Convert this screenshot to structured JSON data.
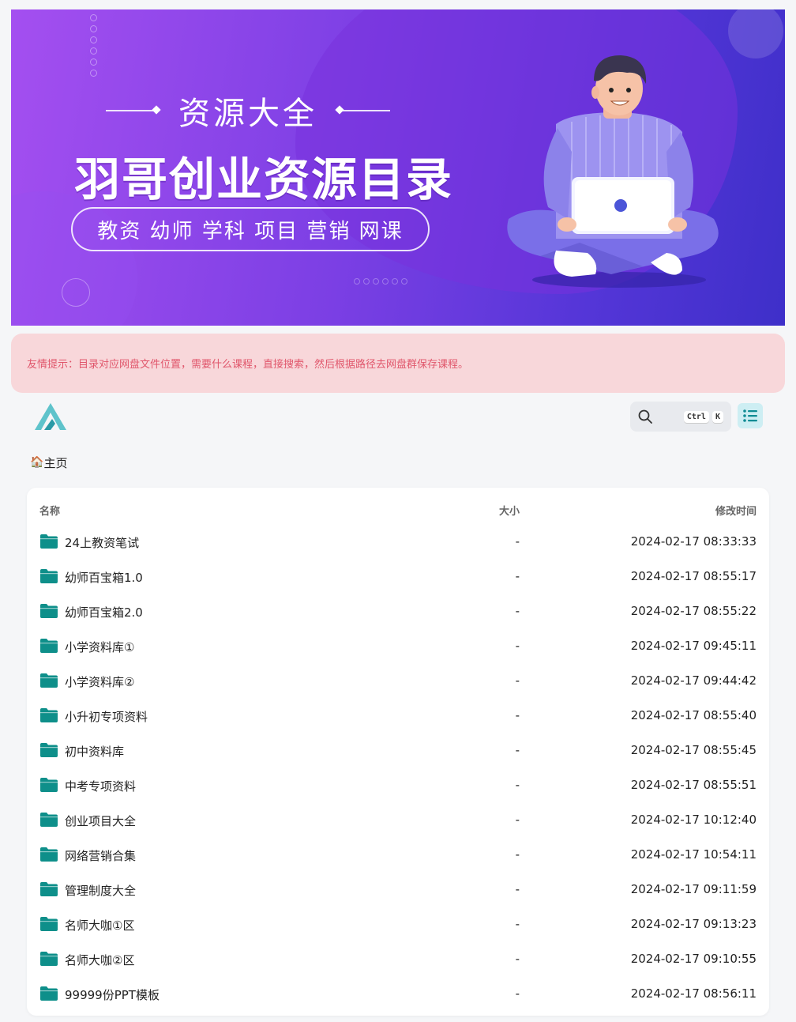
{
  "banner": {
    "sub_title": "资源大全",
    "main_title": "羽哥创业资源目录",
    "tags": "教资 幼师 学科 项目 营销 网课"
  },
  "notice": {
    "text": "友情提示：目录对应网盘文件位置，需要什么课程，直接搜索，然后根据路径去网盘群保存课程。"
  },
  "search": {
    "key_ctrl": "Ctrl",
    "key_k": "K"
  },
  "breadcrumb": {
    "home_icon": "🏠",
    "home_label": "主页"
  },
  "table": {
    "headers": {
      "name": "名称",
      "size": "大小",
      "modified": "修改时间"
    },
    "rows": [
      {
        "name": "24上教资笔试",
        "size": "-",
        "modified": "2024-02-17 08:33:33"
      },
      {
        "name": "幼师百宝箱1.0",
        "size": "-",
        "modified": "2024-02-17 08:55:17"
      },
      {
        "name": "幼师百宝箱2.0",
        "size": "-",
        "modified": "2024-02-17 08:55:22"
      },
      {
        "name": "小学资料库①",
        "size": "-",
        "modified": "2024-02-17 09:45:11"
      },
      {
        "name": "小学资料库②",
        "size": "-",
        "modified": "2024-02-17 09:44:42"
      },
      {
        "name": "小升初专项资料",
        "size": "-",
        "modified": "2024-02-17 08:55:40"
      },
      {
        "name": "初中资料库",
        "size": "-",
        "modified": "2024-02-17 08:55:45"
      },
      {
        "name": "中考专项资料",
        "size": "-",
        "modified": "2024-02-17 08:55:51"
      },
      {
        "name": "创业项目大全",
        "size": "-",
        "modified": "2024-02-17 10:12:40"
      },
      {
        "name": "网络营销合集",
        "size": "-",
        "modified": "2024-02-17 10:54:11"
      },
      {
        "name": "管理制度大全",
        "size": "-",
        "modified": "2024-02-17 09:11:59"
      },
      {
        "name": "名师大咖①区",
        "size": "-",
        "modified": "2024-02-17 09:13:23"
      },
      {
        "name": "名师大咖②区",
        "size": "-",
        "modified": "2024-02-17 09:10:55"
      },
      {
        "name": "99999份PPT模板",
        "size": "-",
        "modified": "2024-02-17 08:56:11"
      }
    ]
  },
  "colors": {
    "folder": "#0e8f8a",
    "notice_bg": "#f8d7da",
    "notice_text": "#e0566b",
    "logo": "#4fb9c2"
  }
}
